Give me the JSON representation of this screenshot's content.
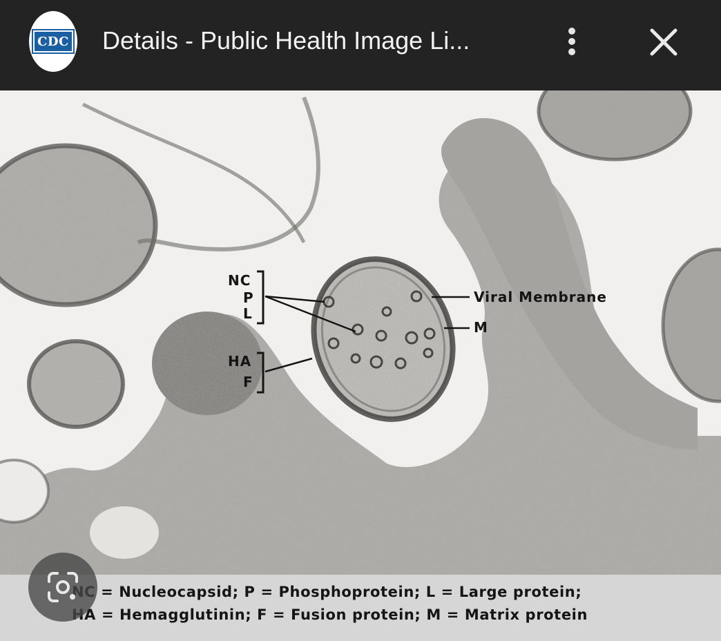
{
  "header": {
    "logo_text": "CDC",
    "title": "Details - Public Health Image Li...",
    "menu_icon": "more-vert-icon",
    "close_icon": "close-icon"
  },
  "image": {
    "labels": {
      "nc": "NC",
      "p": "P",
      "l": "L",
      "ha": "HA",
      "f": "F",
      "viral_membrane": "Viral Membrane",
      "m": "M"
    },
    "caption_line1": "NC = Nucleocapsid; P = Phosphoprotein; L = Large protein;",
    "caption_line2": "HA = Hemagglutinin; F = Fusion protein; M = Matrix protein"
  },
  "overlay": {
    "lens_icon": "google-lens-icon"
  },
  "colors": {
    "header_bg": "#232323",
    "cdc_blue": "#1b5fa3",
    "caption_bg": "#d6d6d6"
  }
}
